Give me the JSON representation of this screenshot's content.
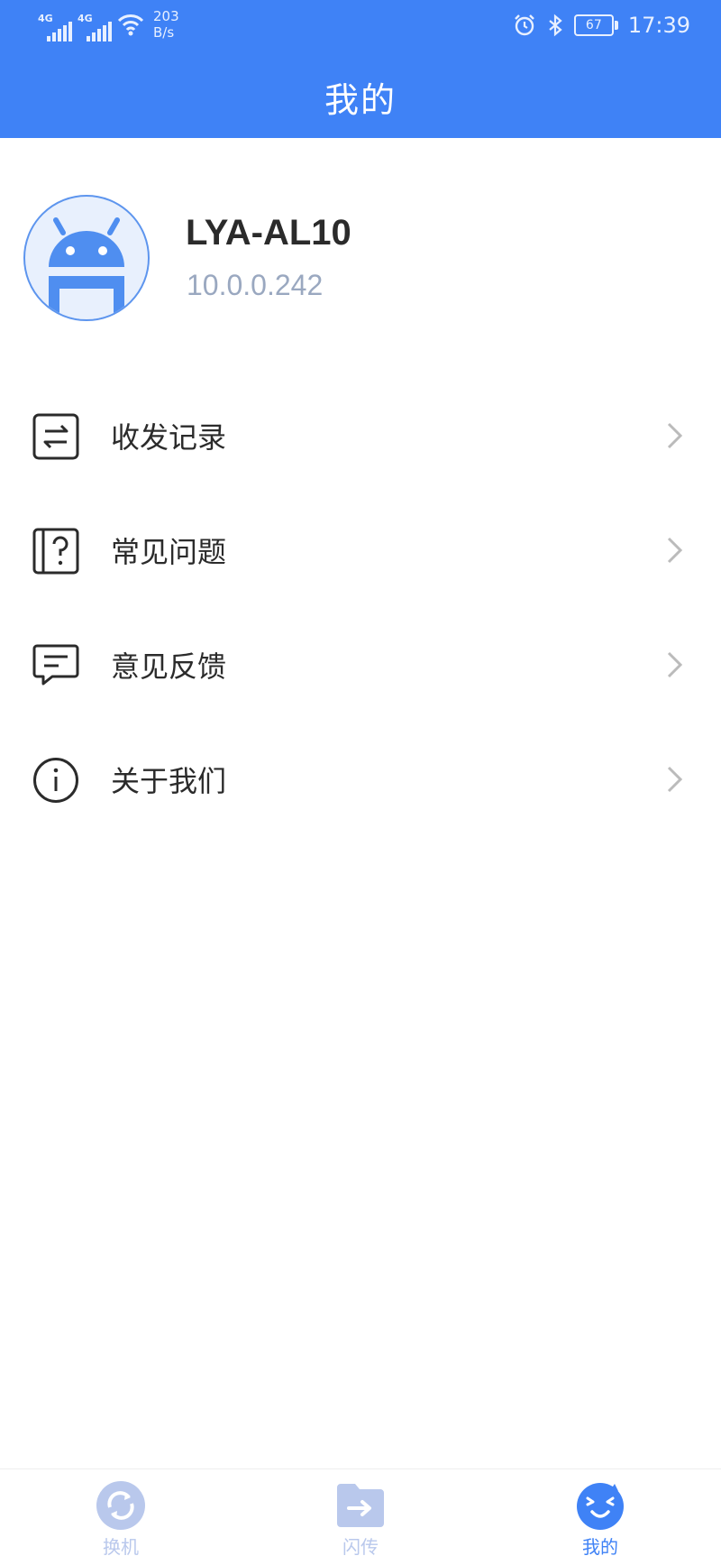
{
  "status_bar": {
    "network_tag_1": "4G",
    "network_tag_2": "4G",
    "net_speed_value": "203",
    "net_speed_unit": "B/s",
    "battery": "67",
    "time": "17:39"
  },
  "header": {
    "title": "我的"
  },
  "profile": {
    "device_name": "LYA-AL10",
    "ip_address": "10.0.0.242",
    "avatar_icon": "android-robot-icon"
  },
  "menu": {
    "items": [
      {
        "label": "收发记录",
        "icon": "transfer-record-icon"
      },
      {
        "label": "常见问题",
        "icon": "faq-book-icon"
      },
      {
        "label": "意见反馈",
        "icon": "feedback-message-icon"
      },
      {
        "label": "关于我们",
        "icon": "info-icon"
      }
    ]
  },
  "bottom_nav": {
    "items": [
      {
        "label": "换机",
        "icon": "switch-phone-icon",
        "active": false
      },
      {
        "label": "闪传",
        "icon": "flash-transfer-icon",
        "active": false
      },
      {
        "label": "我的",
        "icon": "me-face-icon",
        "active": true
      }
    ]
  },
  "colors": {
    "brand_blue": "#3f82f6",
    "inactive_nav": "#b9c8ec",
    "ip_gray": "#9aa8c0"
  }
}
